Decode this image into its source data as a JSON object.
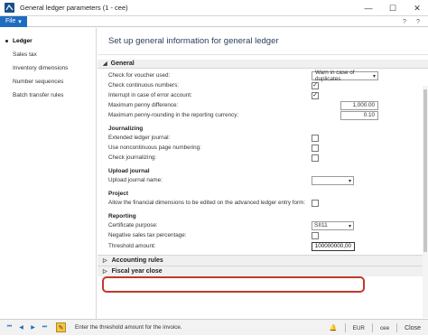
{
  "window": {
    "title": "General ledger parameters (1 - cee)",
    "minimize": "—",
    "maximize": "☐",
    "close": "✕"
  },
  "menu": {
    "file_label": "File",
    "help_buttons": [
      "?",
      "?"
    ]
  },
  "nav": {
    "items": [
      {
        "label": "Ledger",
        "active": true
      },
      {
        "label": "Sales tax",
        "active": false
      },
      {
        "label": "Inventory dimensions",
        "active": false
      },
      {
        "label": "Number sequences",
        "active": false
      },
      {
        "label": "Batch transfer rules",
        "active": false
      }
    ]
  },
  "page": {
    "heading": "Set up general information for general ledger"
  },
  "general": {
    "header": "General",
    "check_voucher_label": "Check for voucher used:",
    "check_voucher_value": "Warn in case of duplicates",
    "continuous_numbers_label": "Check continuous numbers:",
    "continuous_numbers_checked": true,
    "interrupt_label": "Interrupt in case of error account:",
    "interrupt_checked": true,
    "max_penny_label": "Maximum penny difference:",
    "max_penny_value": "1,000.00",
    "max_penny_reporting_label": "Maximum penny-rounding in the reporting currency:",
    "max_penny_reporting_value": "0.10"
  },
  "journalizing": {
    "header": "Journalizing",
    "extended_label": "Extended ledger journal:",
    "extended_checked": false,
    "noncontinuous_label": "Use noncontinuous page numbering:",
    "noncontinuous_checked": false,
    "check_journalizing_label": "Check journalizing:",
    "check_journalizing_checked": false
  },
  "upload": {
    "header": "Upload journal",
    "journal_name_label": "Upload journal name:",
    "journal_name_value": ""
  },
  "project": {
    "header": "Project",
    "allow_dimensions_label": "Allow the financial dimensions to be edited on the advanced ledger entry form:",
    "allow_dimensions_checked": false
  },
  "reporting": {
    "header": "Reporting",
    "certificate_label": "Certificate purpose:",
    "certificate_value": "SII11",
    "negative_tax_label": "Negative sales tax percentage:",
    "negative_tax_checked": false,
    "threshold_label": "Threshold amount:",
    "threshold_value": "100000000,00"
  },
  "collapsed_sections": [
    {
      "label": "Accounting rules"
    },
    {
      "label": "Fiscal year close"
    }
  ],
  "status": {
    "message": "Enter the threshold amount for the invoice.",
    "currency": "EUR",
    "company": "cee",
    "close": "Close"
  }
}
